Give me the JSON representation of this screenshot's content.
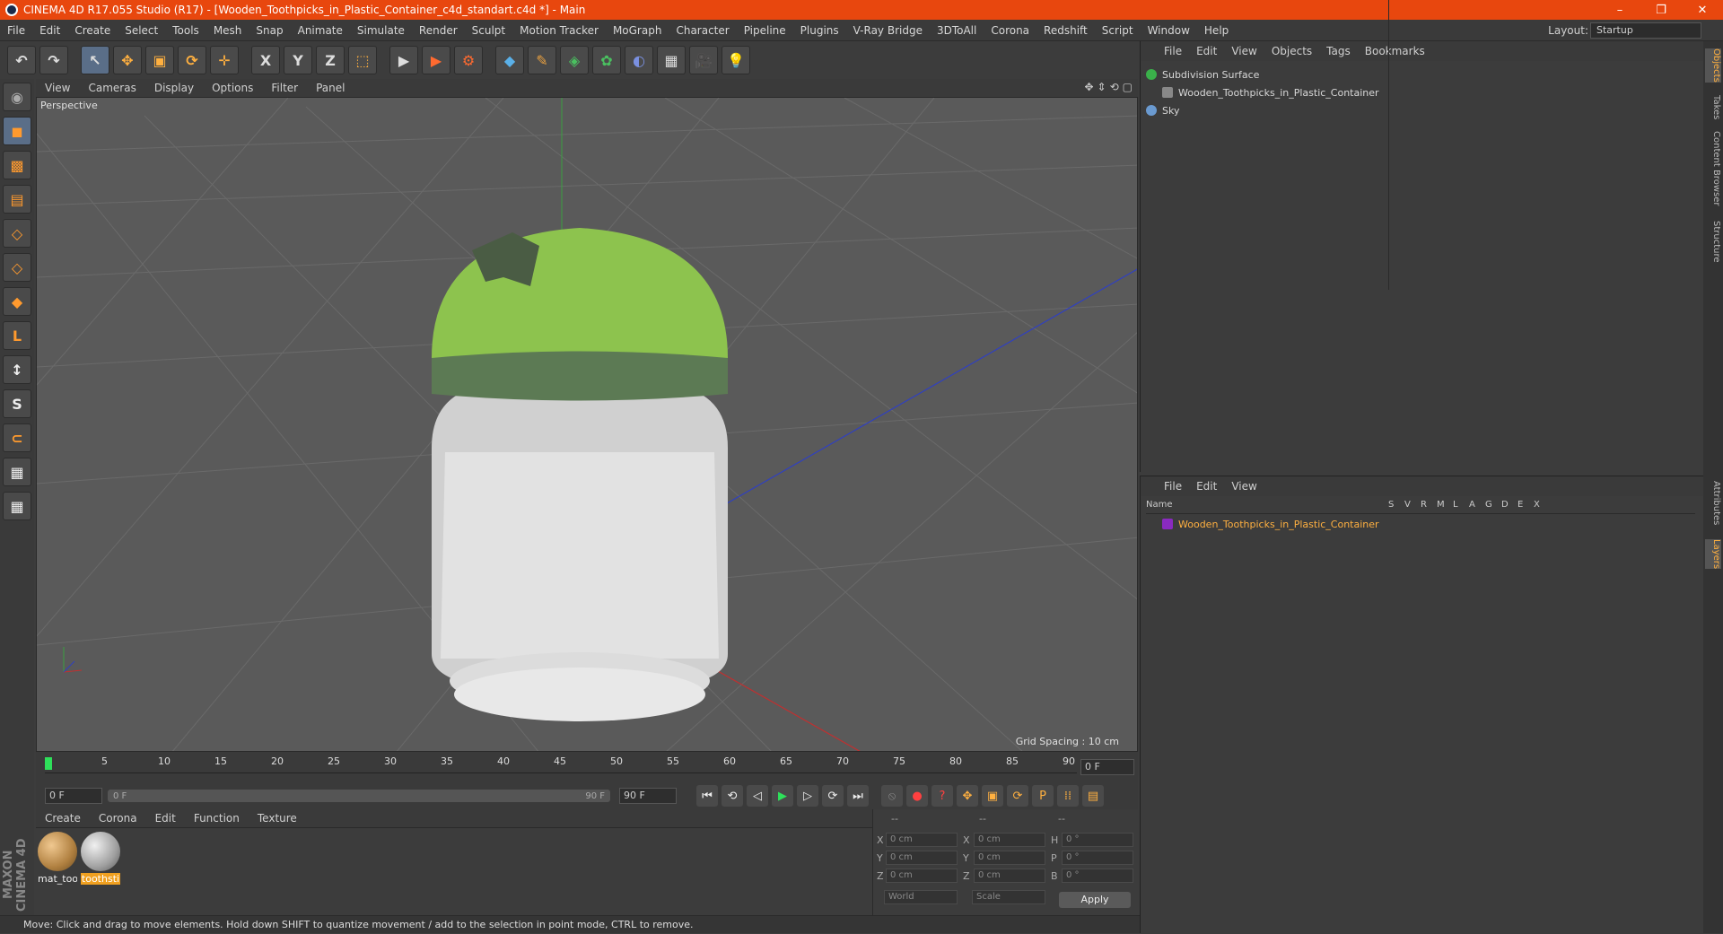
{
  "window": {
    "title": "CINEMA 4D R17.055 Studio (R17) - [Wooden_Toothpicks_in_Plastic_Container_c4d_standart.c4d *] - Main",
    "controls": [
      "–",
      "❐",
      "✕"
    ]
  },
  "menubar": {
    "items": [
      "File",
      "Edit",
      "Create",
      "Select",
      "Tools",
      "Mesh",
      "Snap",
      "Animate",
      "Simulate",
      "Render",
      "Sculpt",
      "Motion Tracker",
      "MoGraph",
      "Character",
      "Pipeline",
      "Plugins",
      "V-Ray Bridge",
      "3DToAll",
      "Corona",
      "Redshift",
      "Script",
      "Window",
      "Help"
    ],
    "layout_label": "Layout:",
    "layout_value": "Startup"
  },
  "toolbar": {
    "undo": "↶",
    "redo": "↷",
    "live_select": "↖",
    "move": "✥",
    "scale": "▣",
    "rotate": "⟳",
    "recent": "✛",
    "x_axis": "X",
    "y_axis": "Y",
    "z_axis": "Z",
    "coord_system": "⬚",
    "render_view": "▶",
    "render_picture": "▶",
    "render_settings": "⚙",
    "cube": "◆",
    "pen": "✎",
    "subdivision": "◈",
    "cloner": "✿",
    "deformer": "◐",
    "floor": "▦",
    "camera": "🎥",
    "light": "💡"
  },
  "left_tools": {
    "make_editable": "◉",
    "model": "◼",
    "texture": "▩",
    "workplane": "▤",
    "points": "◇",
    "edges": "◇",
    "polygons": "◆",
    "axis": "L",
    "tweak": "↕",
    "soft_select": "S",
    "magnet": "⊂",
    "snap_grid": "▦",
    "snap_lock": "▦"
  },
  "viewport": {
    "menu": [
      "View",
      "Cameras",
      "Display",
      "Options",
      "Filter",
      "Panel"
    ],
    "label": "Perspective",
    "grid_spacing": "Grid Spacing : 10 cm",
    "nav_icons": [
      "✥",
      "⇕",
      "⟲",
      "▢"
    ]
  },
  "timeline": {
    "ticks": [
      "0",
      "5",
      "10",
      "15",
      "20",
      "25",
      "30",
      "35",
      "40",
      "45",
      "50",
      "55",
      "60",
      "65",
      "70",
      "75",
      "80",
      "85",
      "90"
    ],
    "end_field": "0 F"
  },
  "playback": {
    "start_field": "0 F",
    "range_start": "0 F",
    "range_end": "90 F",
    "end_field": "90 F",
    "buttons": {
      "to_start": "⏮",
      "prev_key": "⟲",
      "prev_frame": "◁",
      "play": "▶",
      "next_frame": "▷",
      "next_key": "⟳",
      "to_end": "⏭",
      "motion": "⦸",
      "record": "●",
      "auto_key": "?",
      "key_move": "✥",
      "key_scale": "▣",
      "key_rotate": "⟳",
      "key_param": "P",
      "key_pla": "⁞⁞",
      "timeline_btn": "▤"
    }
  },
  "material_manager": {
    "menu": [
      "Create",
      "Corona",
      "Edit",
      "Function",
      "Texture"
    ],
    "materials": [
      {
        "label": "mat_too",
        "color": "#b08040"
      },
      {
        "label": "toothsti",
        "color": "#a0a0a0"
      }
    ]
  },
  "coordinates": {
    "header": [
      "--",
      "--",
      "--"
    ],
    "rows": [
      {
        "axis": "X",
        "pos": "0 cm",
        "size_axis": "X",
        "size": "0 cm",
        "rot_axis": "H",
        "rot": "0 °"
      },
      {
        "axis": "Y",
        "pos": "0 cm",
        "size_axis": "Y",
        "size": "0 cm",
        "rot_axis": "P",
        "rot": "0 °"
      },
      {
        "axis": "Z",
        "pos": "0 cm",
        "size_axis": "Z",
        "size": "0 cm",
        "rot_axis": "B",
        "rot": "0 °"
      }
    ],
    "space": "World",
    "mode": "Scale",
    "apply": "Apply"
  },
  "status": "Move: Click and drag to move elements. Hold down SHIFT to quantize movement / add to the selection in point mode, CTRL to remove.",
  "brand": "MAXON CINEMA 4D",
  "object_manager": {
    "menu": [
      "File",
      "Edit",
      "View",
      "Objects",
      "Tags",
      "Bookmarks"
    ],
    "objects": [
      {
        "name": "Subdivision Surface",
        "icon_color": "#3ab04a",
        "indent": 0
      },
      {
        "name": "Wooden_Toothpicks_in_Plastic_Container",
        "icon_color": "#888888",
        "indent": 1
      },
      {
        "name": "Sky",
        "icon_color": "#6a9ad0",
        "indent": 0
      }
    ]
  },
  "layer_manager": {
    "menu": [
      "File",
      "Edit",
      "View"
    ],
    "columns": [
      "Name",
      "S",
      "V",
      "R",
      "M",
      "L",
      "A",
      "G",
      "D",
      "E",
      "X"
    ],
    "layers": [
      {
        "name": "Wooden_Toothpicks_in_Plastic_Container",
        "color": "#8a2ac0"
      }
    ]
  },
  "right_tabs": [
    "Objects",
    "Takes",
    "Content Browser",
    "Structure",
    "Attributes",
    "Layers"
  ]
}
